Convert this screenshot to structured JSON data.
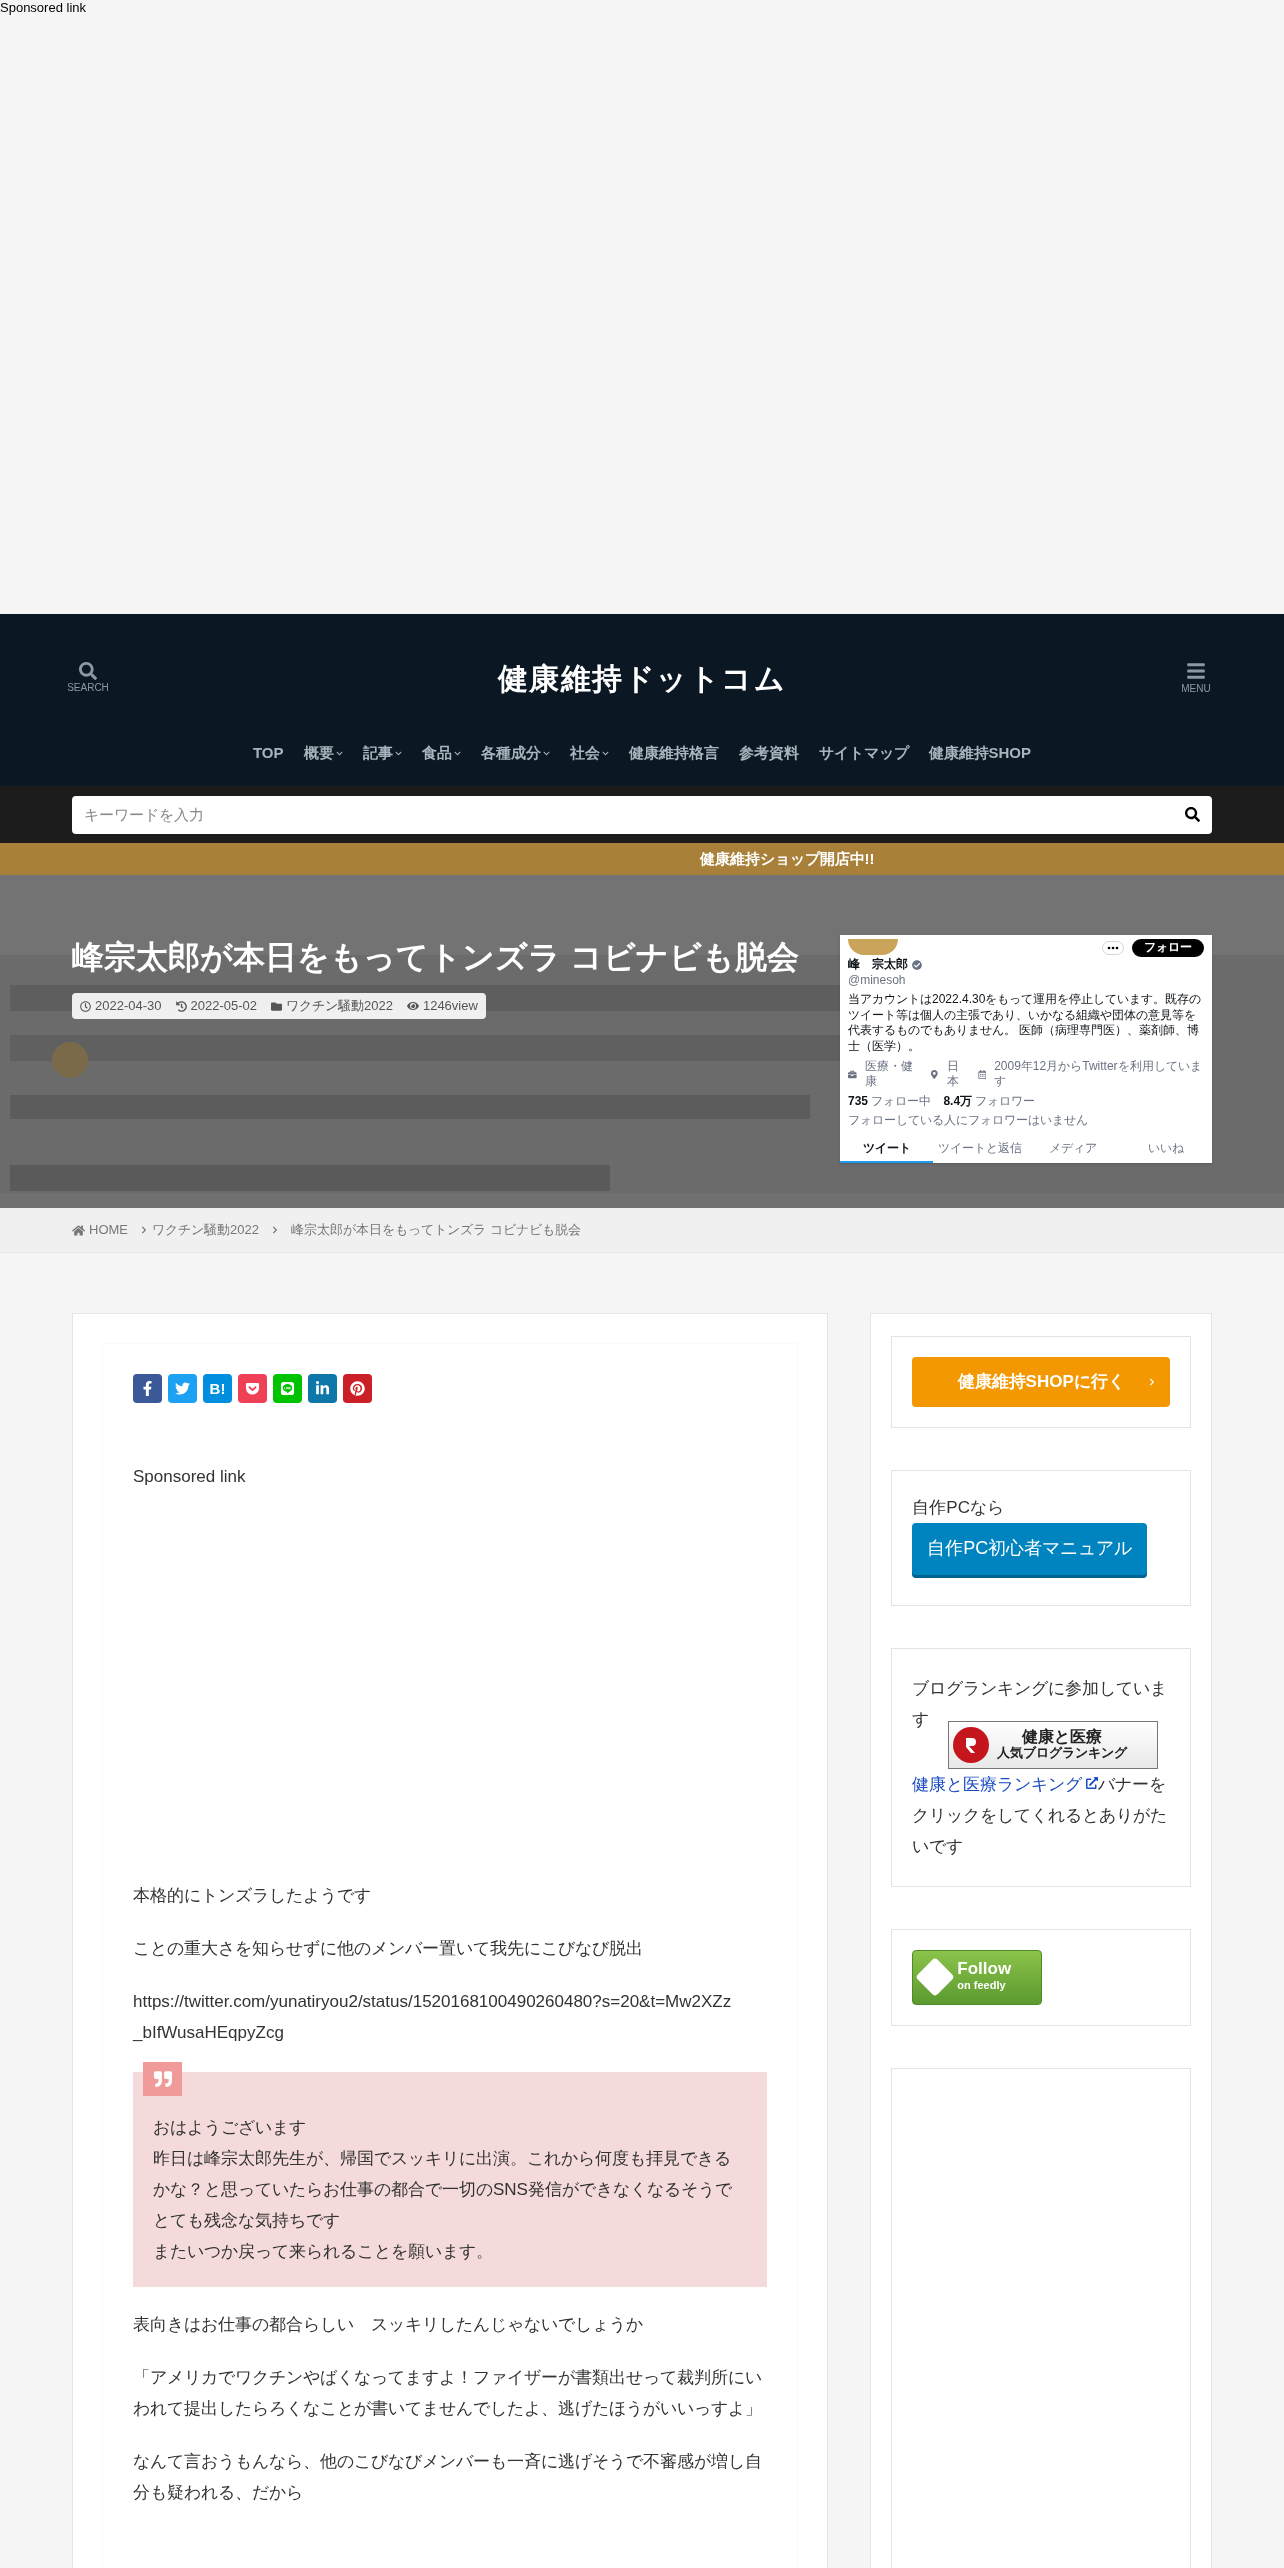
{
  "top_ad": {
    "label": "Sponsored link"
  },
  "header": {
    "search_label": "SEARCH",
    "logo": "健康維持ドットコム",
    "menu_label": "MENU"
  },
  "nav": [
    {
      "label": "TOP",
      "has_menu": false
    },
    {
      "label": "概要",
      "has_menu": true
    },
    {
      "label": "記事",
      "has_menu": true
    },
    {
      "label": "食品",
      "has_menu": true
    },
    {
      "label": "各種成分",
      "has_menu": true
    },
    {
      "label": "社会",
      "has_menu": true
    },
    {
      "label": "健康維持格言",
      "has_menu": false
    },
    {
      "label": "参考資料",
      "has_menu": false
    },
    {
      "label": "サイトマップ",
      "has_menu": false
    },
    {
      "label": "健康維持SHOP",
      "has_menu": false
    }
  ],
  "search": {
    "placeholder": "キーワードを入力"
  },
  "notice": "健康維持ショップ開店中!!",
  "hero": {
    "title": "峰宗太郎が本日をもってトンズラ コビナビも脱会",
    "posted": "2022-04-30",
    "updated": "2022-05-02",
    "category": "ワクチン騒動2022",
    "views": "1246view",
    "thumbnail": {
      "name": "峰　宗太郎",
      "handle": "@minesoh",
      "follow_button": "フォロー",
      "bio": "当アカウントは2022.4.30をもって運用を停止しています。既存のツイート等は個人の主張であり、いかなる組織や団体の意見等を代表するものでもありません。 医師（病理専門医）、薬剤師、博士（医学）。",
      "field": "医療・健康",
      "location": "日本",
      "joined": "2009年12月からTwitterを利用しています",
      "following_count": "735",
      "following_label": "フォロー中",
      "followers_count": "8.4万",
      "followers_label": "フォロワー",
      "note": "フォローしている人にフォロワーはいません",
      "tabs": [
        {
          "label": "ツイート",
          "selected": true
        },
        {
          "label": "ツイートと返信",
          "selected": false
        },
        {
          "label": "メディア",
          "selected": false
        },
        {
          "label": "いいね",
          "selected": false
        }
      ]
    }
  },
  "breadcrumb": [
    "HOME",
    "ワクチン騒動2022",
    "峰宗太郎が本日をもってトンズラ コビナビも脱会"
  ],
  "share_buttons": [
    {
      "kind": "facebook",
      "color": "#3b5998"
    },
    {
      "kind": "twitter",
      "color": "#1da1f2"
    },
    {
      "kind": "hatena",
      "color": "#008fde",
      "label": "B!"
    },
    {
      "kind": "pocket",
      "color": "#ef4056"
    },
    {
      "kind": "line",
      "color": "#00c300"
    },
    {
      "kind": "linkedin",
      "color": "#0e76a8"
    },
    {
      "kind": "pinterest",
      "color": "#cb2027"
    }
  ],
  "article_ad": {
    "label": "Sponsored link"
  },
  "body": [
    {
      "kind": "paragraph",
      "text": "本格的にトンズラしたようです"
    },
    {
      "kind": "paragraph",
      "text": "ことの重大さを知らせずに他のメンバー置いて我先にこびなび脱出"
    },
    {
      "kind": "url",
      "text": "https://twitter.com/yunatiryou2/status/1520168100490260480?s=20&t=Mw2XZz_bIfWusaHEqpyZcg"
    },
    {
      "kind": "quote",
      "lines": [
        "おはようございます",
        "昨日は峰宗太郎先生が、帰国でスッキリに出演。これから何度も拝見できるかな？と思っていたらお仕事の都合で一切のSNS発信ができなくなるそうでとても残念な気持ちです",
        "またいつか戻って来られることを願います。"
      ]
    },
    {
      "kind": "paragraph",
      "text": "表向きはお仕事の都合らしい　スッキリしたんじゃないでしょうか"
    },
    {
      "kind": "paragraph",
      "text": "「アメリカでワクチンやばくなってますよ！ファイザーが書類出せって裁判所にいわれて提出したらろくなことが書いてませんでしたよ、逃げたほうがいいっすよ」"
    },
    {
      "kind": "paragraph",
      "text": "なんて言おうもんなら、他のこびなびメンバーも一斉に逃げそうで不審感が増し自分も疑われる、だから"
    }
  ],
  "sidebar": {
    "shop_button": "健康維持SHOPに行く",
    "pc_intro": "自作PCなら",
    "pc_button": "自作PC初心者マニュアル",
    "ranking": {
      "lead": "ブログランキングに参加しています",
      "banner_title": "健康と医療",
      "banner_subtitle": "人気ブログランキング",
      "link": "健康と医療ランキング",
      "after": "バナーをクリックをしてくれるとありがたいです"
    },
    "feedly": {
      "title": "Follow",
      "subtitle": "on feedly"
    }
  }
}
